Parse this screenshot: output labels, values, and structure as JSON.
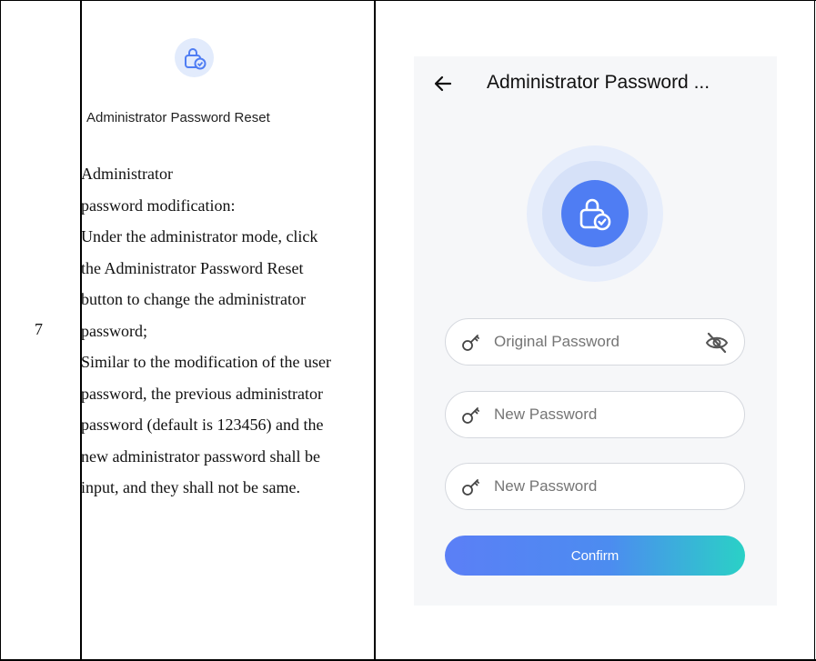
{
  "table": {
    "row_number": "7"
  },
  "left_cell": {
    "icon": "lock-check-icon",
    "caption": "Administrator Password Reset",
    "description_lines": [
      "Administrator",
      "password modification:",
      "Under the administrator mode, click",
      "the Administrator Password Reset",
      "button to change the administrator",
      "password;",
      "Similar to the modification of the user",
      "password, the previous administrator",
      "password (default is 123456) and the",
      "new administrator password shall be",
      "input, and they shall not be same."
    ]
  },
  "screen": {
    "title": "Administrator Password ...",
    "back_icon": "arrow-left-icon",
    "hero_icon": "lock-check-icon",
    "fields": [
      {
        "placeholder": "Original Password",
        "icon": "key-icon",
        "trailing_icon": "eye-off-icon"
      },
      {
        "placeholder": "New Password",
        "icon": "key-icon"
      },
      {
        "placeholder": "New Password",
        "icon": "key-icon"
      }
    ],
    "confirm_label": "Confirm"
  },
  "colors": {
    "accent": "#4f7df3",
    "gradient_end": "#2ad1c6",
    "background": "#f6f7f9"
  }
}
